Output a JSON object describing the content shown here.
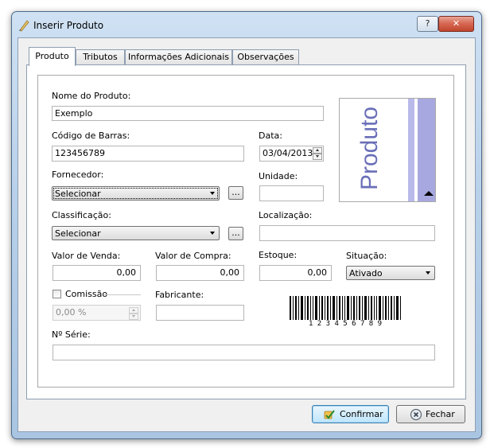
{
  "window": {
    "title": "Inserir Produto",
    "help_label": "?",
    "close_label": "✕"
  },
  "tabs": [
    {
      "label": "Produto",
      "active": true
    },
    {
      "label": "Tributos"
    },
    {
      "label": "Informações Adicionais"
    },
    {
      "label": "Observações"
    }
  ],
  "form": {
    "nome_label": "Nome do Produto:",
    "nome_value": "Exemplo",
    "codigo_label": "Código de Barras:",
    "codigo_value": "123456789",
    "data_label": "Data:",
    "data_value": "03/04/2013",
    "fornecedor_label": "Fornecedor:",
    "fornecedor_value": "Selecionar",
    "unidade_label": "Unidade:",
    "unidade_value": "",
    "classificacao_label": "Classificação:",
    "classificacao_value": "Selecionar",
    "localizacao_label": "Localização:",
    "localizacao_value": "",
    "ellipsis": "...",
    "venda_label": "Valor de Venda:",
    "venda_value": "0,00",
    "compra_label": "Valor de Compra:",
    "compra_value": "0,00",
    "estoque_label": "Estoque:",
    "estoque_value": "0,00",
    "situacao_label": "Situação:",
    "situacao_value": "Ativado",
    "comissao_label": "Comissão",
    "comissao_value": "0,00 %",
    "comissao_checked": false,
    "fabricante_label": "Fabricante:",
    "fabricante_value": "",
    "serie_label": "Nº Série:",
    "serie_value": ""
  },
  "image_placeholder": {
    "text": "Produto"
  },
  "barcode": {
    "digits": "1 2 3 4 5 6 7 8 9"
  },
  "buttons": {
    "confirm": "Confirmar",
    "close": "Fechar"
  },
  "colors": {
    "placeholder_bar": "#a8a8e0",
    "placeholder_text": "#6a6fb8",
    "accent": "#3c7fb1"
  }
}
